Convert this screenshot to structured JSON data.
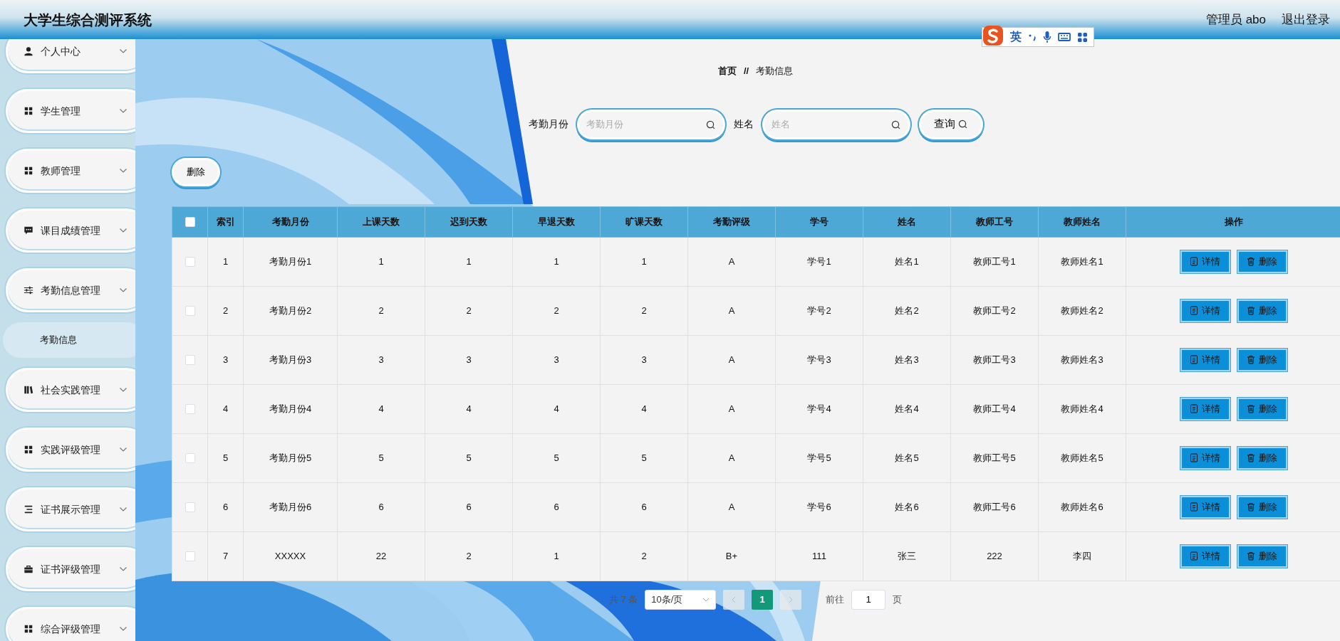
{
  "header": {
    "title": "大学生综合测评系统",
    "user": "管理员 abo",
    "logout": "退出登录"
  },
  "ime_bar": {
    "mode": "英"
  },
  "sidebar": {
    "items": [
      {
        "label": "个人中心",
        "kind": "person"
      },
      {
        "label": "学生管理",
        "kind": "grid"
      },
      {
        "label": "教师管理",
        "kind": "grid"
      },
      {
        "label": "课目成绩管理",
        "kind": "chat"
      },
      {
        "label": "考勤信息管理",
        "kind": "sliders",
        "children": [
          {
            "label": "考勤信息",
            "selected": true
          }
        ]
      },
      {
        "label": "社会实践管理",
        "kind": "books"
      },
      {
        "label": "实践评级管理",
        "kind": "grid"
      },
      {
        "label": "证书展示管理",
        "kind": "list"
      },
      {
        "label": "证书评级管理",
        "kind": "briefcase"
      },
      {
        "label": "综合评级管理",
        "kind": "grid"
      }
    ]
  },
  "breadcrumb": {
    "home": "首页",
    "separator": "//",
    "current": "考勤信息"
  },
  "search": {
    "fields": [
      {
        "label": "考勤月份",
        "placeholder": "考勤月份"
      },
      {
        "label": "姓名",
        "placeholder": "姓名"
      }
    ],
    "button": "查询"
  },
  "toolbar": {
    "delete": "删除"
  },
  "table": {
    "all_checked": false,
    "columns": [
      "索引",
      "考勤月份",
      "上课天数",
      "迟到天数",
      "早退天数",
      "旷课天数",
      "考勤评级",
      "学号",
      "姓名",
      "教师工号",
      "教师姓名",
      "操作"
    ],
    "rows": [
      {
        "checked": false,
        "cells": [
          "1",
          "考勤月份1",
          "1",
          "1",
          "1",
          "1",
          "A",
          "学号1",
          "姓名1",
          "教师工号1",
          "教师姓名1"
        ],
        "actions": [
          "详情",
          "删除"
        ]
      },
      {
        "checked": false,
        "cells": [
          "2",
          "考勤月份2",
          "2",
          "2",
          "2",
          "2",
          "A",
          "学号2",
          "姓名2",
          "教师工号2",
          "教师姓名2"
        ],
        "actions": [
          "详情",
          "删除"
        ]
      },
      {
        "checked": false,
        "cells": [
          "3",
          "考勤月份3",
          "3",
          "3",
          "3",
          "3",
          "A",
          "学号3",
          "姓名3",
          "教师工号3",
          "教师姓名3"
        ],
        "actions": [
          "详情",
          "删除"
        ]
      },
      {
        "checked": false,
        "cells": [
          "4",
          "考勤月份4",
          "4",
          "4",
          "4",
          "4",
          "A",
          "学号4",
          "姓名4",
          "教师工号4",
          "教师姓名4"
        ],
        "actions": [
          "详情",
          "删除"
        ]
      },
      {
        "checked": false,
        "cells": [
          "5",
          "考勤月份5",
          "5",
          "5",
          "5",
          "5",
          "A",
          "学号5",
          "姓名5",
          "教师工号5",
          "教师姓名5"
        ],
        "actions": [
          "详情",
          "删除"
        ]
      },
      {
        "checked": false,
        "cells": [
          "6",
          "考勤月份6",
          "6",
          "6",
          "6",
          "6",
          "A",
          "学号6",
          "姓名6",
          "教师工号6",
          "教师姓名6"
        ],
        "actions": [
          "详情",
          "删除"
        ]
      },
      {
        "checked": false,
        "cells": [
          "7",
          "XXXXX",
          "22",
          "2",
          "1",
          "2",
          "B+",
          "111",
          "张三",
          "222",
          "李四"
        ],
        "actions": [
          "详情",
          "删除"
        ]
      }
    ]
  },
  "pagination": {
    "total": "共 7 条",
    "page_size": "10条/页",
    "prev_disabled": true,
    "next_disabled": true,
    "pages": [
      {
        "label": "1",
        "selected": true
      }
    ],
    "goto_label": "前往",
    "goto_value": "1",
    "goto_suffix": "页"
  }
}
